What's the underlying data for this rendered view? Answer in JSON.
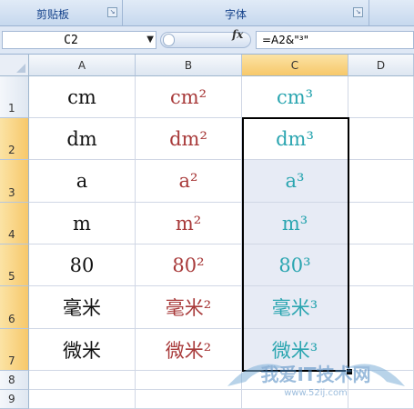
{
  "ribbon": {
    "groups": [
      {
        "label": "剪贴板"
      },
      {
        "label": "字体"
      }
    ]
  },
  "formula_bar": {
    "name_box": "C2",
    "fx_label": "fx",
    "formula": "=A2&\"³\""
  },
  "columns": [
    "A",
    "B",
    "C",
    "D"
  ],
  "rows": [
    "1",
    "2",
    "3",
    "4",
    "5",
    "6",
    "7",
    "8",
    "9"
  ],
  "cells": {
    "A": [
      "cm",
      "dm",
      "a",
      "m",
      "80",
      "毫米",
      "微米"
    ],
    "B": [
      "cm²",
      "dm²",
      "a²",
      "m²",
      "80²",
      "毫米²",
      "微米²"
    ],
    "C": [
      "cm³",
      "dm³",
      "a³",
      "m³",
      "80³",
      "毫米³",
      "微米³"
    ]
  },
  "watermark": {
    "line1": "我爱IT技术网",
    "line2": "www.52ij.com"
  },
  "colors": {
    "col_a": "#111111",
    "col_b": "#a83a3a",
    "col_c": "#2aa5b0",
    "selection_fill": "#e7ebf5"
  }
}
